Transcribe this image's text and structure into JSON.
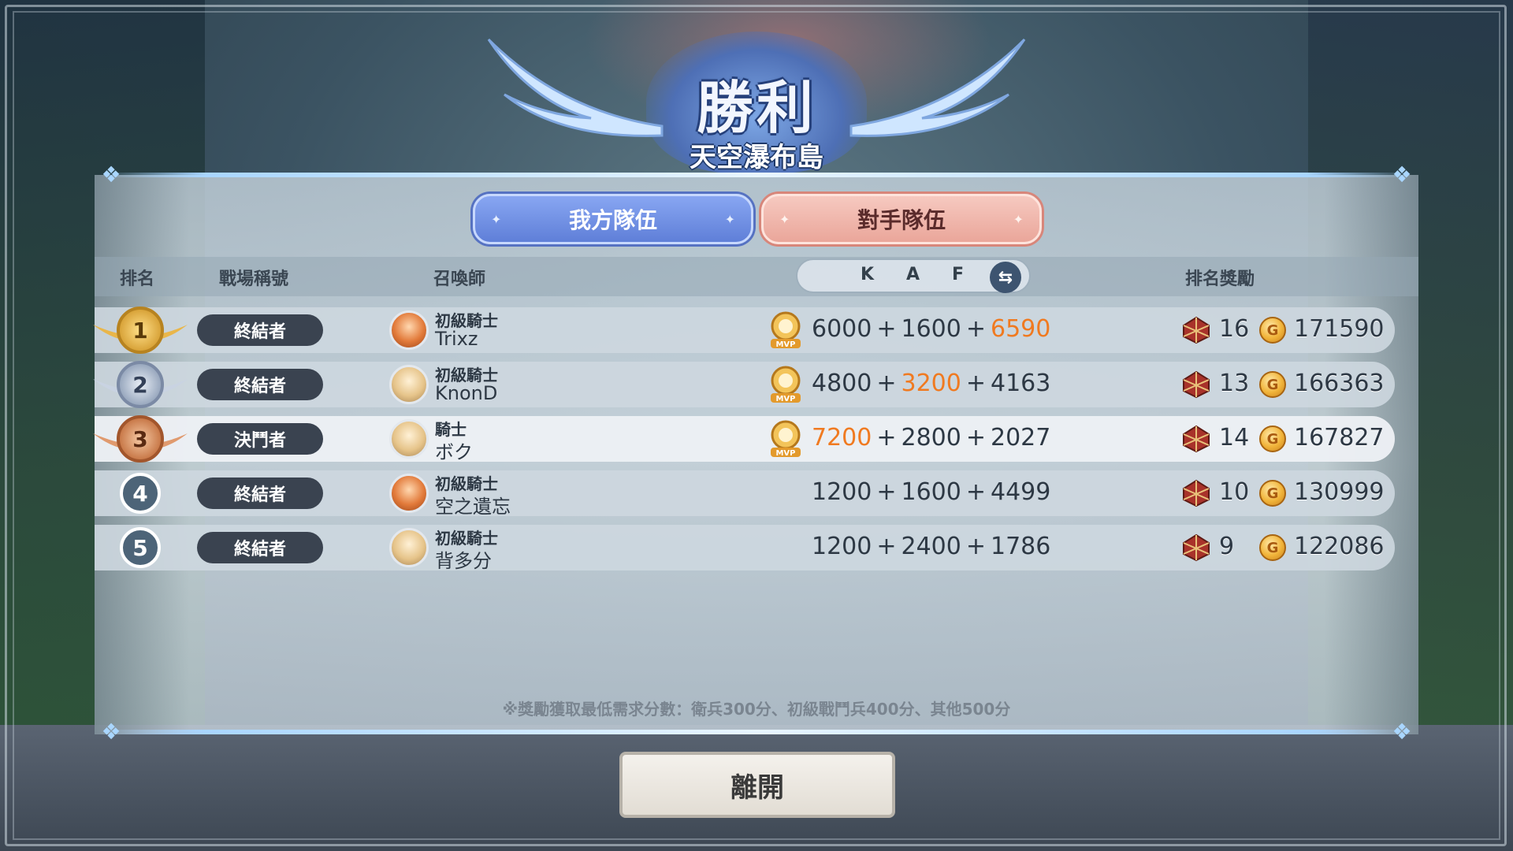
{
  "result": {
    "title": "勝利",
    "subtitle": "天空瀑布島"
  },
  "tabs": {
    "own": "我方隊伍",
    "opponent": "對手隊伍"
  },
  "headers": {
    "rank": "排名",
    "battle_title": "戰場稱號",
    "summoner": "召喚師",
    "k": "K",
    "a": "A",
    "f": "F",
    "reward": "排名獎勵"
  },
  "icons": {
    "swap": "swap-arrows-icon",
    "mvp": "mvp-badge-icon",
    "crate": "reward-crate-icon",
    "coin": "gold-coin-icon"
  },
  "colors": {
    "highlight": "#f07a20",
    "own_tab": "#6f8fe6",
    "opponent_tab": "#efb3a8"
  },
  "players": [
    {
      "rank": "1",
      "title": "終結者",
      "rank_name": "初級騎士",
      "name": "Trixz",
      "k": "6000",
      "a": "1600",
      "f": "6590",
      "highlight": "f",
      "mvp": true,
      "crates": "16",
      "gold": "171590"
    },
    {
      "rank": "2",
      "title": "終結者",
      "rank_name": "初級騎士",
      "name": "KnonD",
      "k": "4800",
      "a": "3200",
      "f": "4163",
      "highlight": "a",
      "mvp": true,
      "crates": "13",
      "gold": "166363"
    },
    {
      "rank": "3",
      "title": "決鬥者",
      "rank_name": "騎士",
      "name": "ボク",
      "k": "7200",
      "a": "2800",
      "f": "2027",
      "highlight": "k",
      "mvp": true,
      "crates": "14",
      "gold": "167827"
    },
    {
      "rank": "4",
      "title": "終結者",
      "rank_name": "初級騎士",
      "name": "空之遺忘",
      "k": "1200",
      "a": "1600",
      "f": "4499",
      "highlight": "",
      "mvp": false,
      "crates": "10",
      "gold": "130999"
    },
    {
      "rank": "5",
      "title": "終結者",
      "rank_name": "初級騎士",
      "name": "背多分",
      "k": "1200",
      "a": "2400",
      "f": "1786",
      "highlight": "",
      "mvp": false,
      "crates": "9",
      "gold": "122086"
    }
  ],
  "plus": "+",
  "mvp_label": "MVP",
  "coin_glyph": "G",
  "footnote": "※獎勵獲取最低需求分數：衛兵300分、初級戰鬥兵400分、其他500分",
  "leave_button": "離開"
}
